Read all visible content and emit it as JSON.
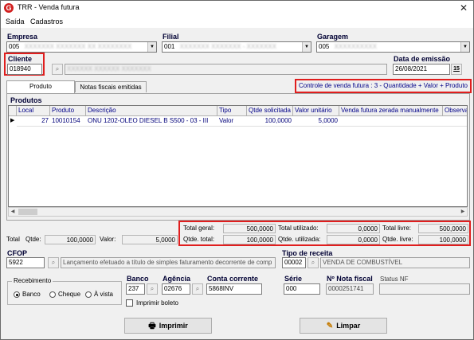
{
  "window": {
    "title": "TRR - Venda futura",
    "app_icon_glyph": "G"
  },
  "menu": [
    "Saída",
    "Cadastros"
  ],
  "empresa": {
    "label": "Empresa",
    "value": "005",
    "desc": "XXXXXXX XXXXXXX XX XXXXXXXX"
  },
  "filial": {
    "label": "Filial",
    "value": "001",
    "desc": "XXXXXXX XXXXXXX - XXXXXXX"
  },
  "garagem": {
    "label": "Garagem",
    "value": "005",
    "desc": "XXXXXXXXXX"
  },
  "cliente": {
    "label": "Cliente",
    "value": "018940",
    "desc": "XXXXXX XXXXXX XXXXXXX"
  },
  "data_emissao": {
    "label": "Data de emissão",
    "value": "26/08/2021",
    "cal_glyph": "15"
  },
  "tabs": [
    "Produto",
    "Notas fiscais emitidas"
  ],
  "controle": "Controle de venda futura : 3 - Quantidade + Valor + Produto",
  "produtos": {
    "title": "Produtos",
    "columns": [
      "Local",
      "Produto",
      "Descrição",
      "Tipo",
      "Qtde solicitada",
      "Valor unitário",
      "Venda futura zerada manualmente",
      "Observa"
    ],
    "rows": [
      [
        "27",
        "10010154",
        "ONU 1202-OLEO DIESEL B S500 - 03 - III",
        "Valor",
        "100,0000",
        "5,0000",
        "",
        ""
      ]
    ]
  },
  "totals": {
    "total_geral_label": "Total geral:",
    "total_geral": "500,0000",
    "total_utilizado_label": "Total utilizado:",
    "total_utilizado": "0,0000",
    "total_livre_label": "Total livre:",
    "total_livre": "500,0000",
    "qtde_total_label": "Qtde. total:",
    "qtde_total": "100,0000",
    "qtde_utilizada_label": "Qtde. utilizada:",
    "qtde_utilizada": "0,0000",
    "qtde_livre_label": "Qtde. livre:",
    "qtde_livre": "100,0000"
  },
  "summary": {
    "total_label": "Total",
    "qtde_label": "Qtde:",
    "qtde": "100,0000",
    "valor_label": "Valor:",
    "valor": "5,0000"
  },
  "cfop": {
    "label": "CFOP",
    "value": "5922",
    "desc": "Lançamento efetuado a título de simples faturamento decorrente de comp"
  },
  "tipo_receita": {
    "label": "Tipo de receita",
    "value": "00002",
    "desc": "VENDA DE COMBUSTÍVEL"
  },
  "recebimento": {
    "label": "Recebimento",
    "options": [
      "Banco",
      "Cheque",
      "À vista"
    ],
    "selected": 0
  },
  "banco": {
    "label": "Banco",
    "value": "237"
  },
  "agencia": {
    "label": "Agência",
    "value": "02676"
  },
  "conta": {
    "label": "Conta corrente",
    "value": "5868INV"
  },
  "serie": {
    "label": "Série",
    "value": "000"
  },
  "nota_fiscal": {
    "label": "Nº Nota fiscal",
    "value": "0000251741"
  },
  "status_nf": {
    "label": "Status NF",
    "value": ""
  },
  "imprimir_boleto": "Imprimir boleto",
  "buttons": {
    "imprimir": "Imprimir",
    "limpar": "Limpar"
  }
}
